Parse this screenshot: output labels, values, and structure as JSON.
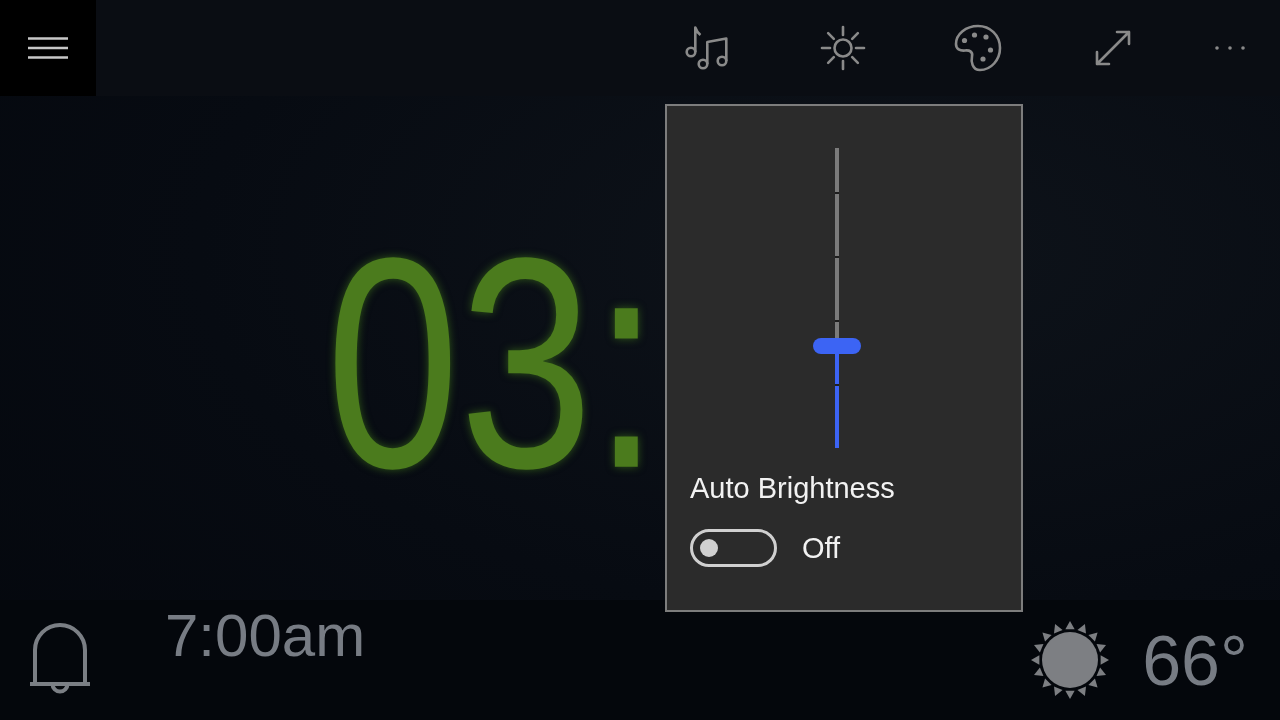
{
  "clock": {
    "time": "03:"
  },
  "brightness_popup": {
    "slider": {
      "level": 0.34
    },
    "label": "Auto Brightness",
    "toggle": {
      "on": false,
      "state_label": "Off"
    }
  },
  "alarm": {
    "time": "7:00am"
  },
  "weather": {
    "temperature": "66°"
  }
}
